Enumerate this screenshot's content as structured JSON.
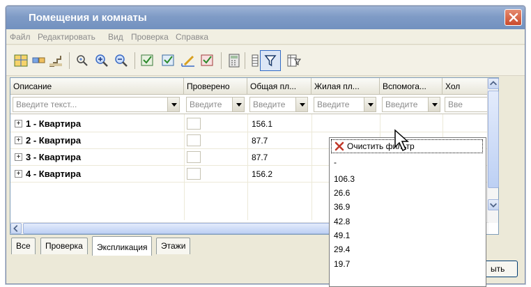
{
  "window": {
    "title": "Помещения и комнаты"
  },
  "menu": [
    "Файл",
    "Редактировать",
    "Вид",
    "Проверка",
    "Справка"
  ],
  "toolbar": {
    "icons": [
      "grid-icon",
      "rooms-icon",
      "stairs-icon",
      "zoom-fit-icon",
      "zoom-in-icon",
      "zoom-out-icon",
      "select-icon",
      "select-alt-icon",
      "area-icon",
      "check-icon",
      "calculator-icon",
      "columns-icon",
      "filter-icon",
      "table-filter-icon"
    ]
  },
  "grid": {
    "columns": [
      "Описание",
      "Проверено",
      "Общая пл...",
      "Жилая пл...",
      "Вспомога...",
      "Хол"
    ],
    "filters": [
      "Введите текст...",
      "Введите",
      "Введите",
      "Введите",
      "Введите",
      "Вве"
    ],
    "rows": [
      {
        "label": "1 - Квартира",
        "total": "156.1"
      },
      {
        "label": "2 - Квартира",
        "total": "87.7"
      },
      {
        "label": "3 - Квартира",
        "total": "87.7"
      },
      {
        "label": "4 - Квартира",
        "total": "156.2"
      }
    ]
  },
  "tabs": [
    "Все",
    "Проверка",
    "Экспликация",
    "Этажи"
  ],
  "active_tab": "Экспликация",
  "bottom_button": "ыть",
  "dropdown": {
    "clear_label": "Очистить фильтр",
    "options": [
      "-",
      "106.3",
      "26.6",
      "36.9",
      "42.8",
      "49.1",
      "29.4",
      "19.7"
    ]
  },
  "colors": {
    "title_gradient": "#7f9bc6",
    "close": "#c94a2c",
    "selection": "#316ac5"
  }
}
